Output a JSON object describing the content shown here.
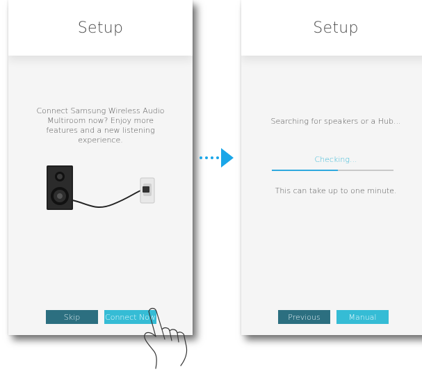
{
  "step1": {
    "title": "Setup",
    "description": "Connect Samsung Wireless Audio Multiroom now? Enjoy more features and a new listening experience.",
    "skip_label": "Skip",
    "connect_label": "Connect Now"
  },
  "step2": {
    "title": "Setup",
    "searching_text": "Searching for speakers or a Hub...",
    "checking_text": "Checking...",
    "progress_fraction": 0.54,
    "wait_text": "This can take up to one minute.",
    "previous_label": "Previous",
    "manual_label": "Manual"
  },
  "icons": {
    "speaker": "speaker-icon",
    "plug": "power-plug-icon",
    "arrow": "arrow-right-icon",
    "hand": "hand-pointer-icon"
  },
  "colors": {
    "accent": "#35bcd5",
    "button_dark": "#2c6f80",
    "progress": "#2fa9de",
    "arrow": "#1aa6e8"
  }
}
